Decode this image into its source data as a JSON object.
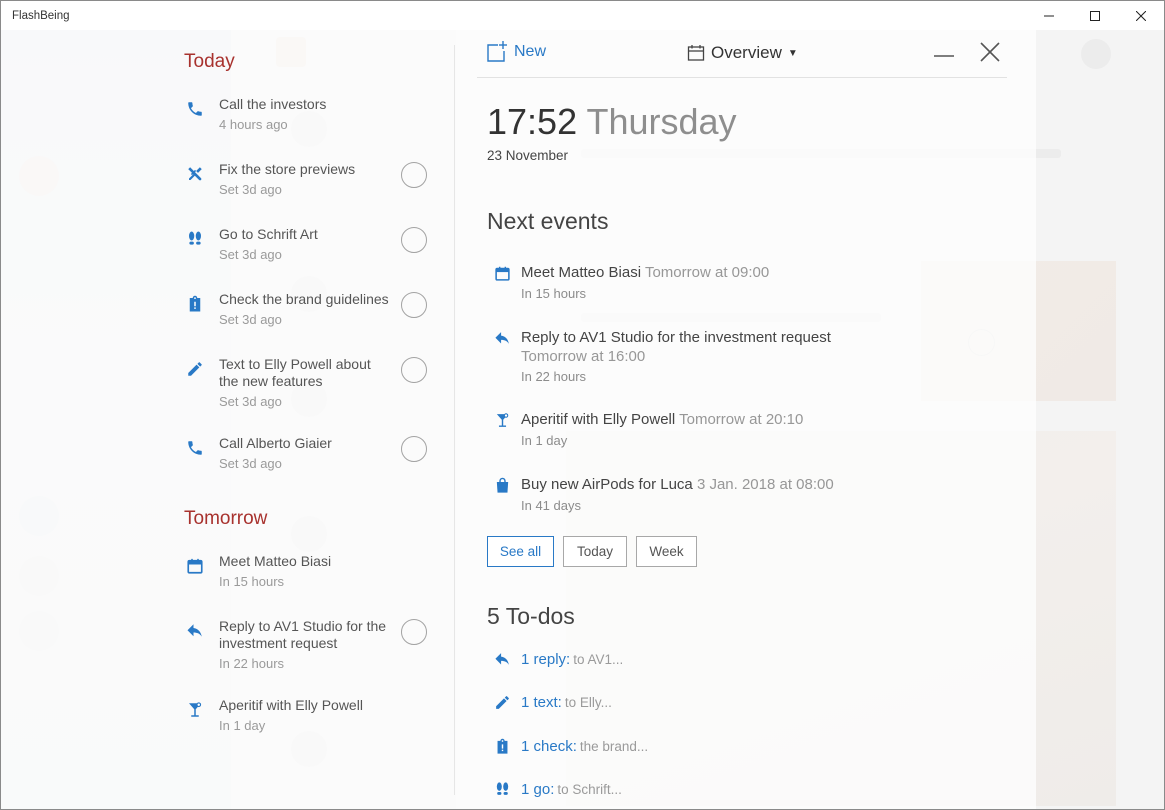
{
  "window": {
    "title": "FlashBeing"
  },
  "timeline": {
    "sections": [
      {
        "heading": "Today"
      },
      {
        "heading": "Tomorrow"
      }
    ],
    "today": [
      {
        "icon": "phone-icon",
        "title": "Call the investors",
        "subtitle": "4 hours ago",
        "checkbox": false
      },
      {
        "icon": "tools-icon",
        "title": "Fix the store previews",
        "subtitle": "Set 3d ago",
        "checkbox": true
      },
      {
        "icon": "footsteps-icon",
        "title": "Go to Schrift Art",
        "subtitle": "Set 3d ago",
        "checkbox": true
      },
      {
        "icon": "clipboard-icon",
        "title": "Check the brand guidelines",
        "subtitle": "Set 3d ago",
        "checkbox": true
      },
      {
        "icon": "pencil-icon",
        "title": "Text to Elly Powell about the new features",
        "subtitle": "Set 3d ago",
        "checkbox": true
      },
      {
        "icon": "phone-icon",
        "title": "Call Alberto Giaier",
        "subtitle": "Set 3d ago",
        "checkbox": true
      }
    ],
    "tomorrow": [
      {
        "icon": "calendar-icon",
        "title": "Meet Matteo Biasi",
        "subtitle": "In 15 hours",
        "checkbox": false
      },
      {
        "icon": "reply-icon",
        "title": "Reply to AV1 Studio for the investment request",
        "subtitle": "In 22 hours",
        "checkbox": true
      },
      {
        "icon": "cocktail-icon",
        "title": "Aperitif with Elly Powell",
        "subtitle": "In 1 day",
        "checkbox": false
      }
    ]
  },
  "overview": {
    "new_label": "New",
    "view_label": "Overview",
    "time": "17:52",
    "weekday": "Thursday",
    "date": "23 November",
    "next_events_heading": "Next events",
    "events": [
      {
        "icon": "calendar-icon",
        "title": "Meet Matteo Biasi",
        "when": "Tomorrow at 09:00",
        "sub": "In 15 hours"
      },
      {
        "icon": "reply-icon",
        "title": "Reply to AV1 Studio for the investment request",
        "when": "Tomorrow at 16:00",
        "sub": "In 22 hours"
      },
      {
        "icon": "cocktail-icon",
        "title": "Aperitif with Elly Powell",
        "when": "Tomorrow at 20:10",
        "sub": "In 1 day"
      },
      {
        "icon": "shopping-bag-icon",
        "title": "Buy new AirPods for Luca",
        "when": "3 Jan. 2018 at 08:00",
        "sub": "In 41 days"
      }
    ],
    "filters": [
      "See all",
      "Today",
      "Week"
    ],
    "todos_heading": "5 To-dos",
    "todos": [
      {
        "icon": "reply-icon",
        "count": "1 reply:",
        "detail": "to AV1..."
      },
      {
        "icon": "pencil-icon",
        "count": "1 text:",
        "detail": "to Elly..."
      },
      {
        "icon": "clipboard-icon",
        "count": "1 check:",
        "detail": "the brand..."
      },
      {
        "icon": "footsteps-icon",
        "count": "1 go:",
        "detail": "to Schrift..."
      }
    ]
  },
  "colors": {
    "accent": "#2979c6",
    "section_heading": "#a8322e"
  }
}
